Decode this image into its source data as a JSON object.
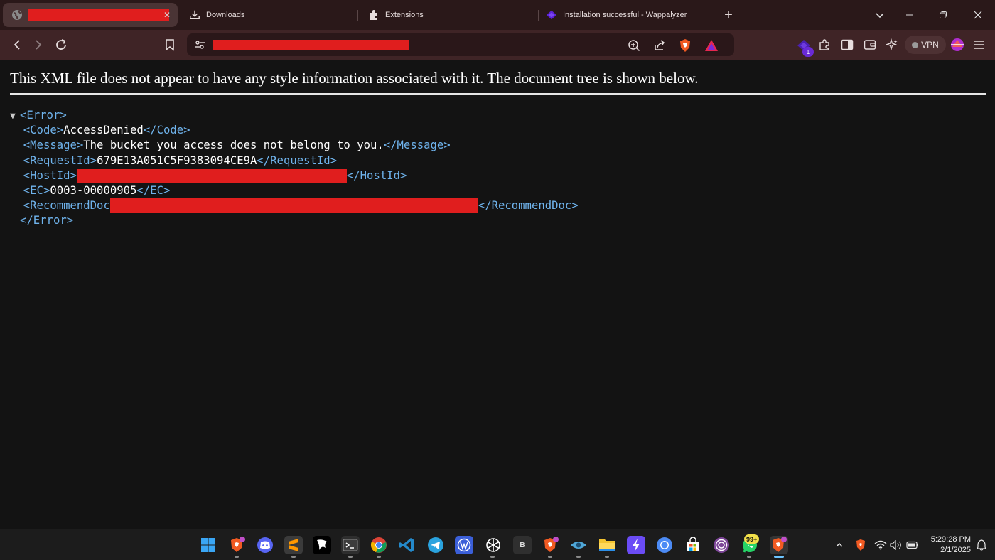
{
  "tabs": {
    "active": {
      "title_redacted": true
    },
    "downloads": {
      "label": "Downloads"
    },
    "extensions": {
      "label": "Extensions"
    },
    "wappalyzer": {
      "label": "Installation successful - Wappalyzer"
    }
  },
  "toolbar": {
    "vpn_label": "VPN",
    "extension_badge": "1"
  },
  "page": {
    "notice": "This XML file does not appear to have any style information associated with it. The document tree is shown below.",
    "xml": {
      "toggle": "▼",
      "error_open": "<Error>",
      "code_open": "<Code>",
      "code_value": "AccessDenied",
      "code_close": "</Code>",
      "message_open": "<Message>",
      "message_value": "The bucket you access does not belong to you.",
      "message_close": "</Message>",
      "requestid_open": "<RequestId>",
      "requestid_value": "679E13A051C5F9383094CE9A",
      "requestid_close": "</RequestId>",
      "hostid_open": "<HostId>",
      "hostid_close": "</HostId>",
      "ec_open": "<EC>",
      "ec_value": "0003-00000905",
      "ec_close": "</EC>",
      "recommenddoc_open": "<RecommendDoc",
      "recommenddoc_close": "</RecommendDoc>",
      "error_close": "</Error>"
    }
  },
  "taskbar": {
    "whatsapp_badge": "99+",
    "bitwarden_label": "B",
    "time": "5:29:28 PM",
    "date": "2/1/2025"
  },
  "colors": {
    "tag": "#6fb3ec",
    "redaction": "#e01e1e",
    "tabbar": "#2a1819",
    "toolbar": "#3f2426"
  }
}
